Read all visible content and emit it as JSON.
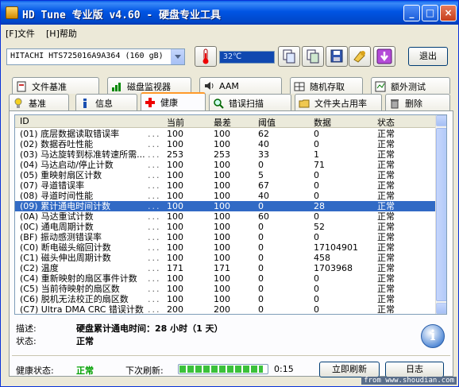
{
  "window": {
    "title": "HD Tune 专业版 v4.60 - 硬盘专业工具",
    "min_label": "_",
    "max_label": "□",
    "close_label": "×"
  },
  "menu": {
    "items": [
      {
        "label": "[F]文件"
      },
      {
        "label": "[H]帮助"
      }
    ]
  },
  "toolbar": {
    "drive": "HITACHI HTS725016A9A364  (160 gB)",
    "temperature": "32℃",
    "exit_label": "退出"
  },
  "tabs": {
    "row1": [
      {
        "label": "文件基准",
        "icon": "file-benchmark-icon"
      },
      {
        "label": "磁盘监视器",
        "icon": "disk-monitor-icon"
      },
      {
        "label": "AAM",
        "icon": "speaker-icon"
      },
      {
        "label": "随机存取",
        "icon": "random-access-icon"
      },
      {
        "label": "额外测试",
        "icon": "extra-tests-icon"
      }
    ],
    "row2": [
      {
        "label": "基准",
        "icon": "benchmark-icon"
      },
      {
        "label": "信息",
        "icon": "info-icon"
      },
      {
        "label": "健康",
        "icon": "health-cross-icon",
        "active": true
      },
      {
        "label": "错误扫描",
        "icon": "magnifier-icon"
      },
      {
        "label": "文件夹占用率",
        "icon": "folder-icon"
      },
      {
        "label": "删除",
        "icon": "trash-icon"
      }
    ]
  },
  "table": {
    "columns": [
      "ID",
      "当前",
      "最差",
      "阈值",
      "数据",
      "状态"
    ],
    "rows": [
      {
        "id": "(01) 底层数据读取错误率",
        "cur": "100",
        "worst": "100",
        "thr": "62",
        "data": "0",
        "status": "正常"
      },
      {
        "id": "(02) 数据吞吐性能",
        "cur": "100",
        "worst": "100",
        "thr": "40",
        "data": "0",
        "status": "正常"
      },
      {
        "id": "(03) 马达旋转到标准转速所需...",
        "cur": "253",
        "worst": "253",
        "thr": "33",
        "data": "1",
        "status": "正常"
      },
      {
        "id": "(04) 马达启动/停止计数",
        "cur": "100",
        "worst": "100",
        "thr": "0",
        "data": "71",
        "status": "正常"
      },
      {
        "id": "(05) 重映射扇区计数",
        "cur": "100",
        "worst": "100",
        "thr": "5",
        "data": "0",
        "status": "正常"
      },
      {
        "id": "(07) 寻道错误率",
        "cur": "100",
        "worst": "100",
        "thr": "67",
        "data": "0",
        "status": "正常"
      },
      {
        "id": "(08) 寻道时间性能",
        "cur": "100",
        "worst": "100",
        "thr": "40",
        "data": "0",
        "status": "正常"
      },
      {
        "id": "(09) 累计通电时间计数",
        "cur": "100",
        "worst": "100",
        "thr": "0",
        "data": "28",
        "status": "正常",
        "selected": true
      },
      {
        "id": "(0A) 马达重试计数",
        "cur": "100",
        "worst": "100",
        "thr": "60",
        "data": "0",
        "status": "正常"
      },
      {
        "id": "(0C) 通电周期计数",
        "cur": "100",
        "worst": "100",
        "thr": "0",
        "data": "52",
        "status": "正常"
      },
      {
        "id": "(BF) 振动感测错误率",
        "cur": "100",
        "worst": "100",
        "thr": "0",
        "data": "0",
        "status": "正常"
      },
      {
        "id": "(C0) 断电磁头缩回计数",
        "cur": "100",
        "worst": "100",
        "thr": "0",
        "data": "17104901",
        "status": "正常"
      },
      {
        "id": "(C1) 磁头伸出周期计数",
        "cur": "100",
        "worst": "100",
        "thr": "0",
        "data": "458",
        "status": "正常"
      },
      {
        "id": "(C2) 温度",
        "cur": "171",
        "worst": "171",
        "thr": "0",
        "data": "1703968",
        "status": "正常"
      },
      {
        "id": "(C4) 重新映射的扇区事件计数",
        "cur": "100",
        "worst": "100",
        "thr": "0",
        "data": "0",
        "status": "正常"
      },
      {
        "id": "(C5) 当前待映射的扇区数",
        "cur": "100",
        "worst": "100",
        "thr": "0",
        "data": "0",
        "status": "正常"
      },
      {
        "id": "(C6) 脱机无法校正的扇区数",
        "cur": "100",
        "worst": "100",
        "thr": "0",
        "data": "0",
        "status": "正常"
      },
      {
        "id": "(C7) Ultra DMA CRC 错误计数",
        "cur": "200",
        "worst": "200",
        "thr": "0",
        "data": "0",
        "status": "正常"
      }
    ]
  },
  "detail": {
    "desc_label": "描述:",
    "desc_value": "硬盘累计通电时间：28 小时（1 天）",
    "status_label": "状态:",
    "status_value": "正常"
  },
  "footer": {
    "health_label": "健康状态:",
    "health_value": "正常",
    "refresh_label": "下次刷新:",
    "refresh_progress": 0.95,
    "refresh_time": "0:15",
    "refresh_now_label": "立即刷新",
    "log_label": "日志",
    "watermark": "from www.shoudian.com"
  }
}
